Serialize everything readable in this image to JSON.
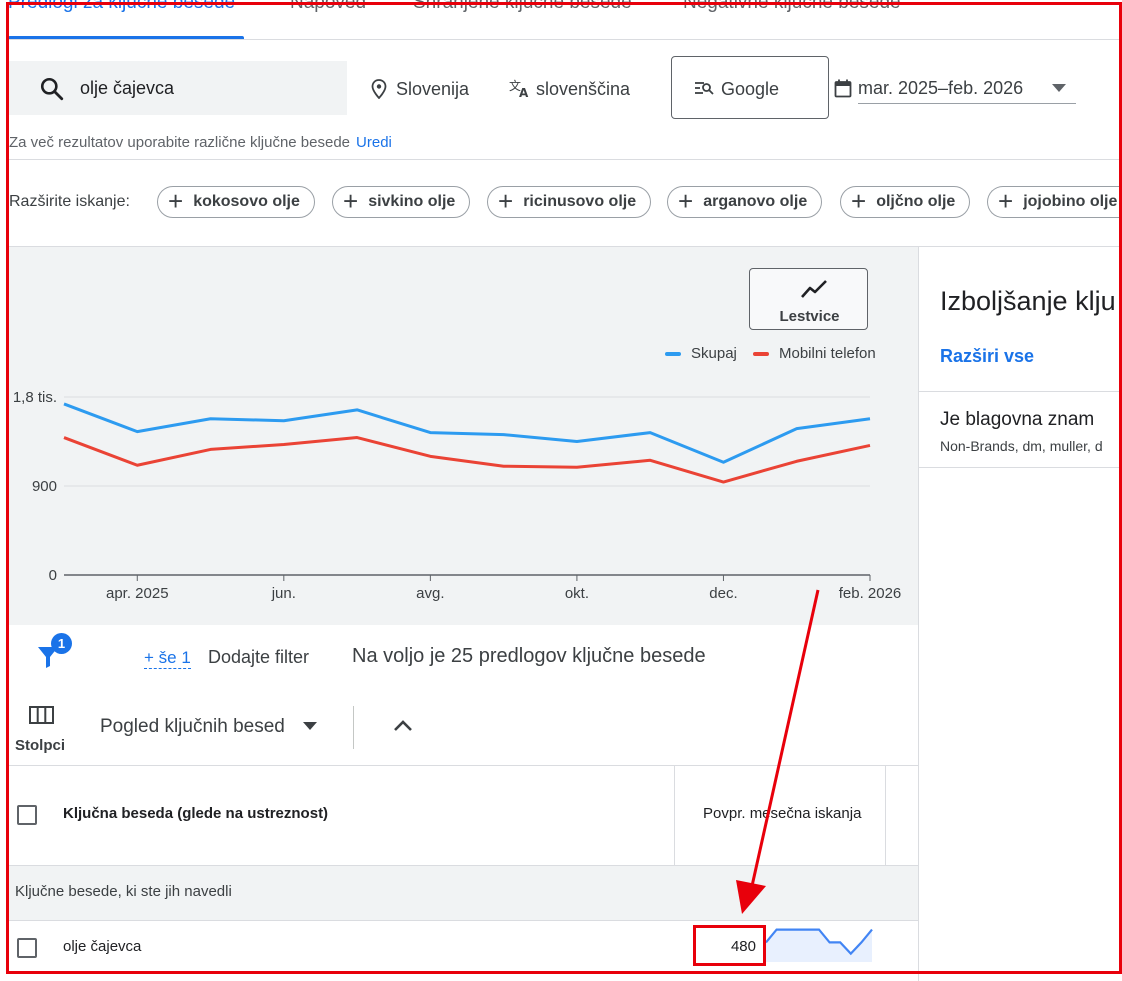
{
  "tabs": [
    {
      "label": "Predlogi za ključne besede",
      "active": true
    },
    {
      "label": "Napoved",
      "active": false
    },
    {
      "label": "Shranjene ključne besede",
      "active": false
    },
    {
      "label": "Negativne ključne besede",
      "active": false
    }
  ],
  "search": {
    "keyword": "olje čajevca",
    "location": "Slovenija",
    "language": "slovenščina",
    "network": "Google",
    "date_range": "mar. 2025–feb. 2026"
  },
  "hint": {
    "text": "Za več rezultatov uporabite različne ključne besede",
    "link": "Uredi"
  },
  "refine": {
    "label": "Razširite iskanje:",
    "chips": [
      "kokosovo olje",
      "sivkino olje",
      "ricinusovo olje",
      "arganovo olje",
      "oljčno olje",
      "jojobino olje"
    ]
  },
  "chart_toggle": {
    "label": "Lestvice"
  },
  "chart_data": {
    "type": "line",
    "x": [
      "mar. 2025",
      "apr. 2025",
      "maj 2025",
      "jun. 2025",
      "jul. 2025",
      "avg. 2025",
      "sep. 2025",
      "okt. 2025",
      "nov. 2025",
      "dec. 2025",
      "jan. 2026",
      "feb. 2026"
    ],
    "xtick_labels": [
      "apr. 2025",
      "jun.",
      "avg.",
      "okt.",
      "dec.",
      "feb. 2026"
    ],
    "ytick_labels": [
      "0",
      "900",
      "1,8 tis."
    ],
    "ylim": [
      0,
      1800
    ],
    "grid": true,
    "legend_position": "top-right",
    "series": [
      {
        "name": "Skupaj",
        "color": "#2d9bf0",
        "values": [
          1730,
          1450,
          1580,
          1560,
          1670,
          1440,
          1420,
          1350,
          1440,
          1140,
          1480,
          1580
        ]
      },
      {
        "name": "Mobilni telefon",
        "color": "#ea4335",
        "values": [
          1390,
          1110,
          1270,
          1320,
          1390,
          1200,
          1100,
          1090,
          1160,
          940,
          1150,
          1310
        ]
      }
    ]
  },
  "right_panel": {
    "title": "Izboljšanje klju",
    "expand_label": "Razširi vse",
    "question": "Je blagovna znam",
    "subtitle": "Non-Brands, dm, muller, d"
  },
  "filter": {
    "badge": "1",
    "more_link": "+ še 1",
    "add_filter": "Dodajte filter",
    "result_count": "Na voljo je 25 predlogov ključne besede"
  },
  "view": {
    "columns_label": "Stolpci",
    "keyword_view": "Pogled ključnih besed"
  },
  "table": {
    "col_keyword": "Ključna beseda (glede na ustreznost)",
    "col_avg": "Povpr. mesečna iskanja",
    "group_label": "Ključne besede, ki ste jih navedli",
    "rows": [
      {
        "keyword": "olje čajevca",
        "avg_monthly": "480",
        "trend": [
          0.55,
          0.95,
          0.95,
          0.95,
          0.95,
          0.95,
          0.55,
          0.55,
          0.2,
          0.55,
          0.95
        ]
      }
    ]
  },
  "colors": {
    "accent": "#1a73e8",
    "annotation": "#e8000b"
  }
}
